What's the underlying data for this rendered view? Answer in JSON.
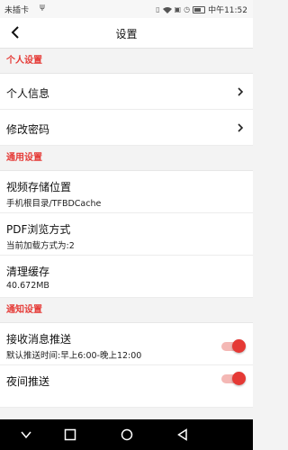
{
  "status_bar": {
    "carrier": "未插卡",
    "usb_icon": "usb-icon",
    "time": "中午11:52",
    "icons": [
      "vibrate-icon",
      "wifi-icon",
      "sim-icon",
      "alarm-icon",
      "battery-icon"
    ]
  },
  "app_bar": {
    "back_icon": "back-arrow-icon",
    "title": "设置"
  },
  "sections": {
    "personal": {
      "header": "个人设置",
      "items": [
        {
          "label": "个人信息",
          "icon": "chevron-right-icon"
        },
        {
          "label": "修改密码",
          "icon": "chevron-right-icon"
        }
      ]
    },
    "general": {
      "header": "通用设置",
      "items": [
        {
          "label": "视频存储位置",
          "sub": "手机根目录/TFBDCache"
        },
        {
          "label": "PDF浏览方式",
          "sub": "当前加载方式为:2"
        },
        {
          "label": "清理缓存",
          "sub": "40.672MB"
        }
      ]
    },
    "notification": {
      "header": "通知设置",
      "items": [
        {
          "label": "接收消息推送",
          "sub": "默认推送时间:早上6:00-晚上12:00",
          "toggle_on": true
        },
        {
          "label": "夜间推送",
          "toggle_on": true
        }
      ]
    }
  },
  "colors": {
    "accent": "#e53935",
    "toggle_track": "#f4b8b5",
    "background": "#f3f3f3",
    "navbar": "#000000"
  },
  "nav_bar": {
    "icons": [
      "expand-down-icon",
      "recents-square-icon",
      "home-circle-icon",
      "back-triangle-icon"
    ]
  }
}
